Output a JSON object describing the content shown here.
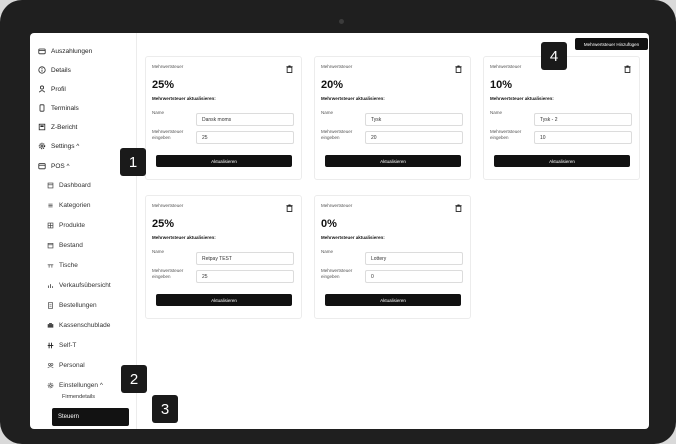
{
  "sidebar": {
    "items": [
      {
        "label": "Auszahlungen",
        "icon": "wallet-icon"
      },
      {
        "label": "Details",
        "icon": "info-icon"
      },
      {
        "label": "Profil",
        "icon": "user-icon"
      },
      {
        "label": "Terminals",
        "icon": "terminal-icon"
      },
      {
        "label": "Z-Bericht",
        "icon": "report-icon"
      },
      {
        "label": "Settings ^",
        "icon": "gear-icon"
      },
      {
        "label": "POS ^",
        "icon": "pos-icon"
      }
    ],
    "pos_items": [
      {
        "label": "Dashboard",
        "icon": "dashboard-icon"
      },
      {
        "label": "Kategorien",
        "icon": "list-icon"
      },
      {
        "label": "Produkte",
        "icon": "grid-icon"
      },
      {
        "label": "Bestand",
        "icon": "box-icon"
      },
      {
        "label": "Tische",
        "icon": "table-icon"
      },
      {
        "label": "Verkaufsübersicht",
        "icon": "chart-icon"
      },
      {
        "label": "Bestellungen",
        "icon": "receipt-icon"
      },
      {
        "label": "Kassenschublade",
        "icon": "drawer-icon"
      },
      {
        "label": "Self-T",
        "icon": "selft-icon"
      },
      {
        "label": "Personal",
        "icon": "people-icon"
      },
      {
        "label": "Einstellungen ^",
        "icon": "gear-icon"
      }
    ],
    "settings_items": [
      {
        "label": "Firmendetails"
      }
    ],
    "active_item": "Steuern"
  },
  "main": {
    "add_button_label": "Mehrwertsteuer Hinzufügen",
    "card_title": "Mehrwertsteuer",
    "update_label": "Mehrwertsteuer aktualisieren:",
    "name_label": "Name",
    "value_label": "Mehrwertsteuer eingeben",
    "button_label": "Aktualisieren",
    "cards": [
      {
        "percent": "25%",
        "name": "Dansk moms",
        "value": "25"
      },
      {
        "percent": "20%",
        "name": "Tysk",
        "value": "20"
      },
      {
        "percent": "10%",
        "name": "Tysk - 2",
        "value": "10"
      },
      {
        "percent": "25%",
        "name": "Retpay TEST",
        "value": "25"
      },
      {
        "percent": "0%",
        "name": "Lottery",
        "value": "0"
      }
    ]
  },
  "badges": [
    "1",
    "2",
    "3",
    "4"
  ]
}
